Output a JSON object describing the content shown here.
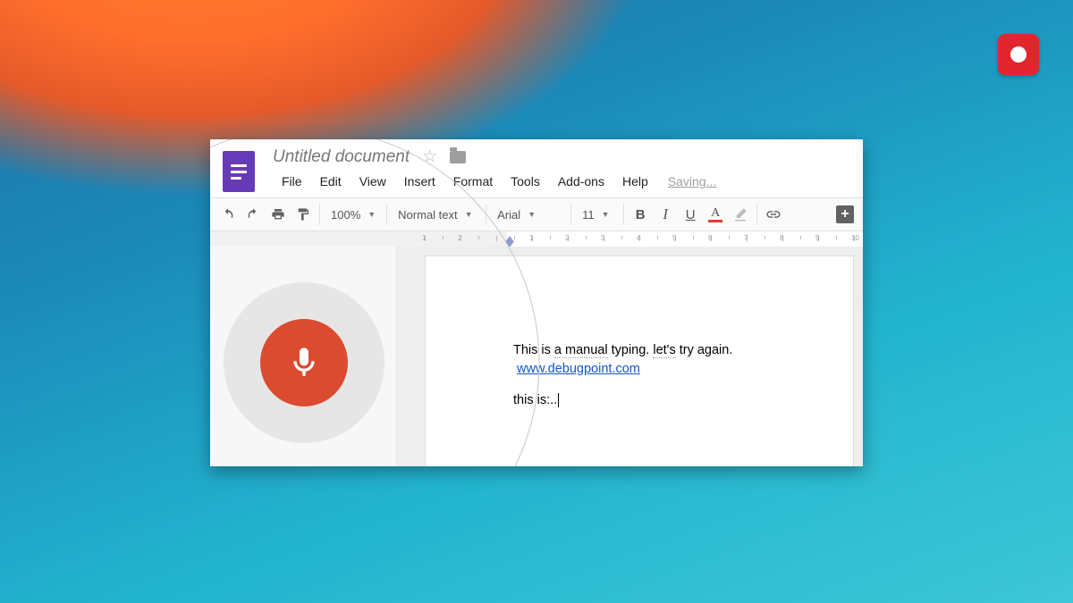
{
  "recorder": {
    "state": "recording"
  },
  "doc": {
    "title": "Untitled document",
    "menus": [
      "File",
      "Edit",
      "View",
      "Insert",
      "Format",
      "Tools",
      "Add-ons",
      "Help"
    ],
    "saving_label": "Saving..."
  },
  "toolbar": {
    "zoom": "100%",
    "style": "Normal text",
    "font": "Arial",
    "font_size": "11",
    "bold": "B",
    "italic": "I",
    "underline": "U",
    "text_color_char": "A",
    "text_color": "#e53935"
  },
  "ruler": {
    "numbers": [
      "1",
      "2",
      "1",
      "1",
      "1",
      "2",
      "3",
      "4",
      "5",
      "6",
      "7",
      "8",
      "9",
      "10"
    ]
  },
  "content": {
    "line1a": "This is ",
    "line1b": "a manual",
    "line1c": " typing.  ",
    "line1d": "let's",
    "line1e": " try again.",
    "link_text": "www.debugpoint.com",
    "line3": "this is:.."
  },
  "voice": {
    "active": true,
    "icon": "microphone-icon"
  }
}
